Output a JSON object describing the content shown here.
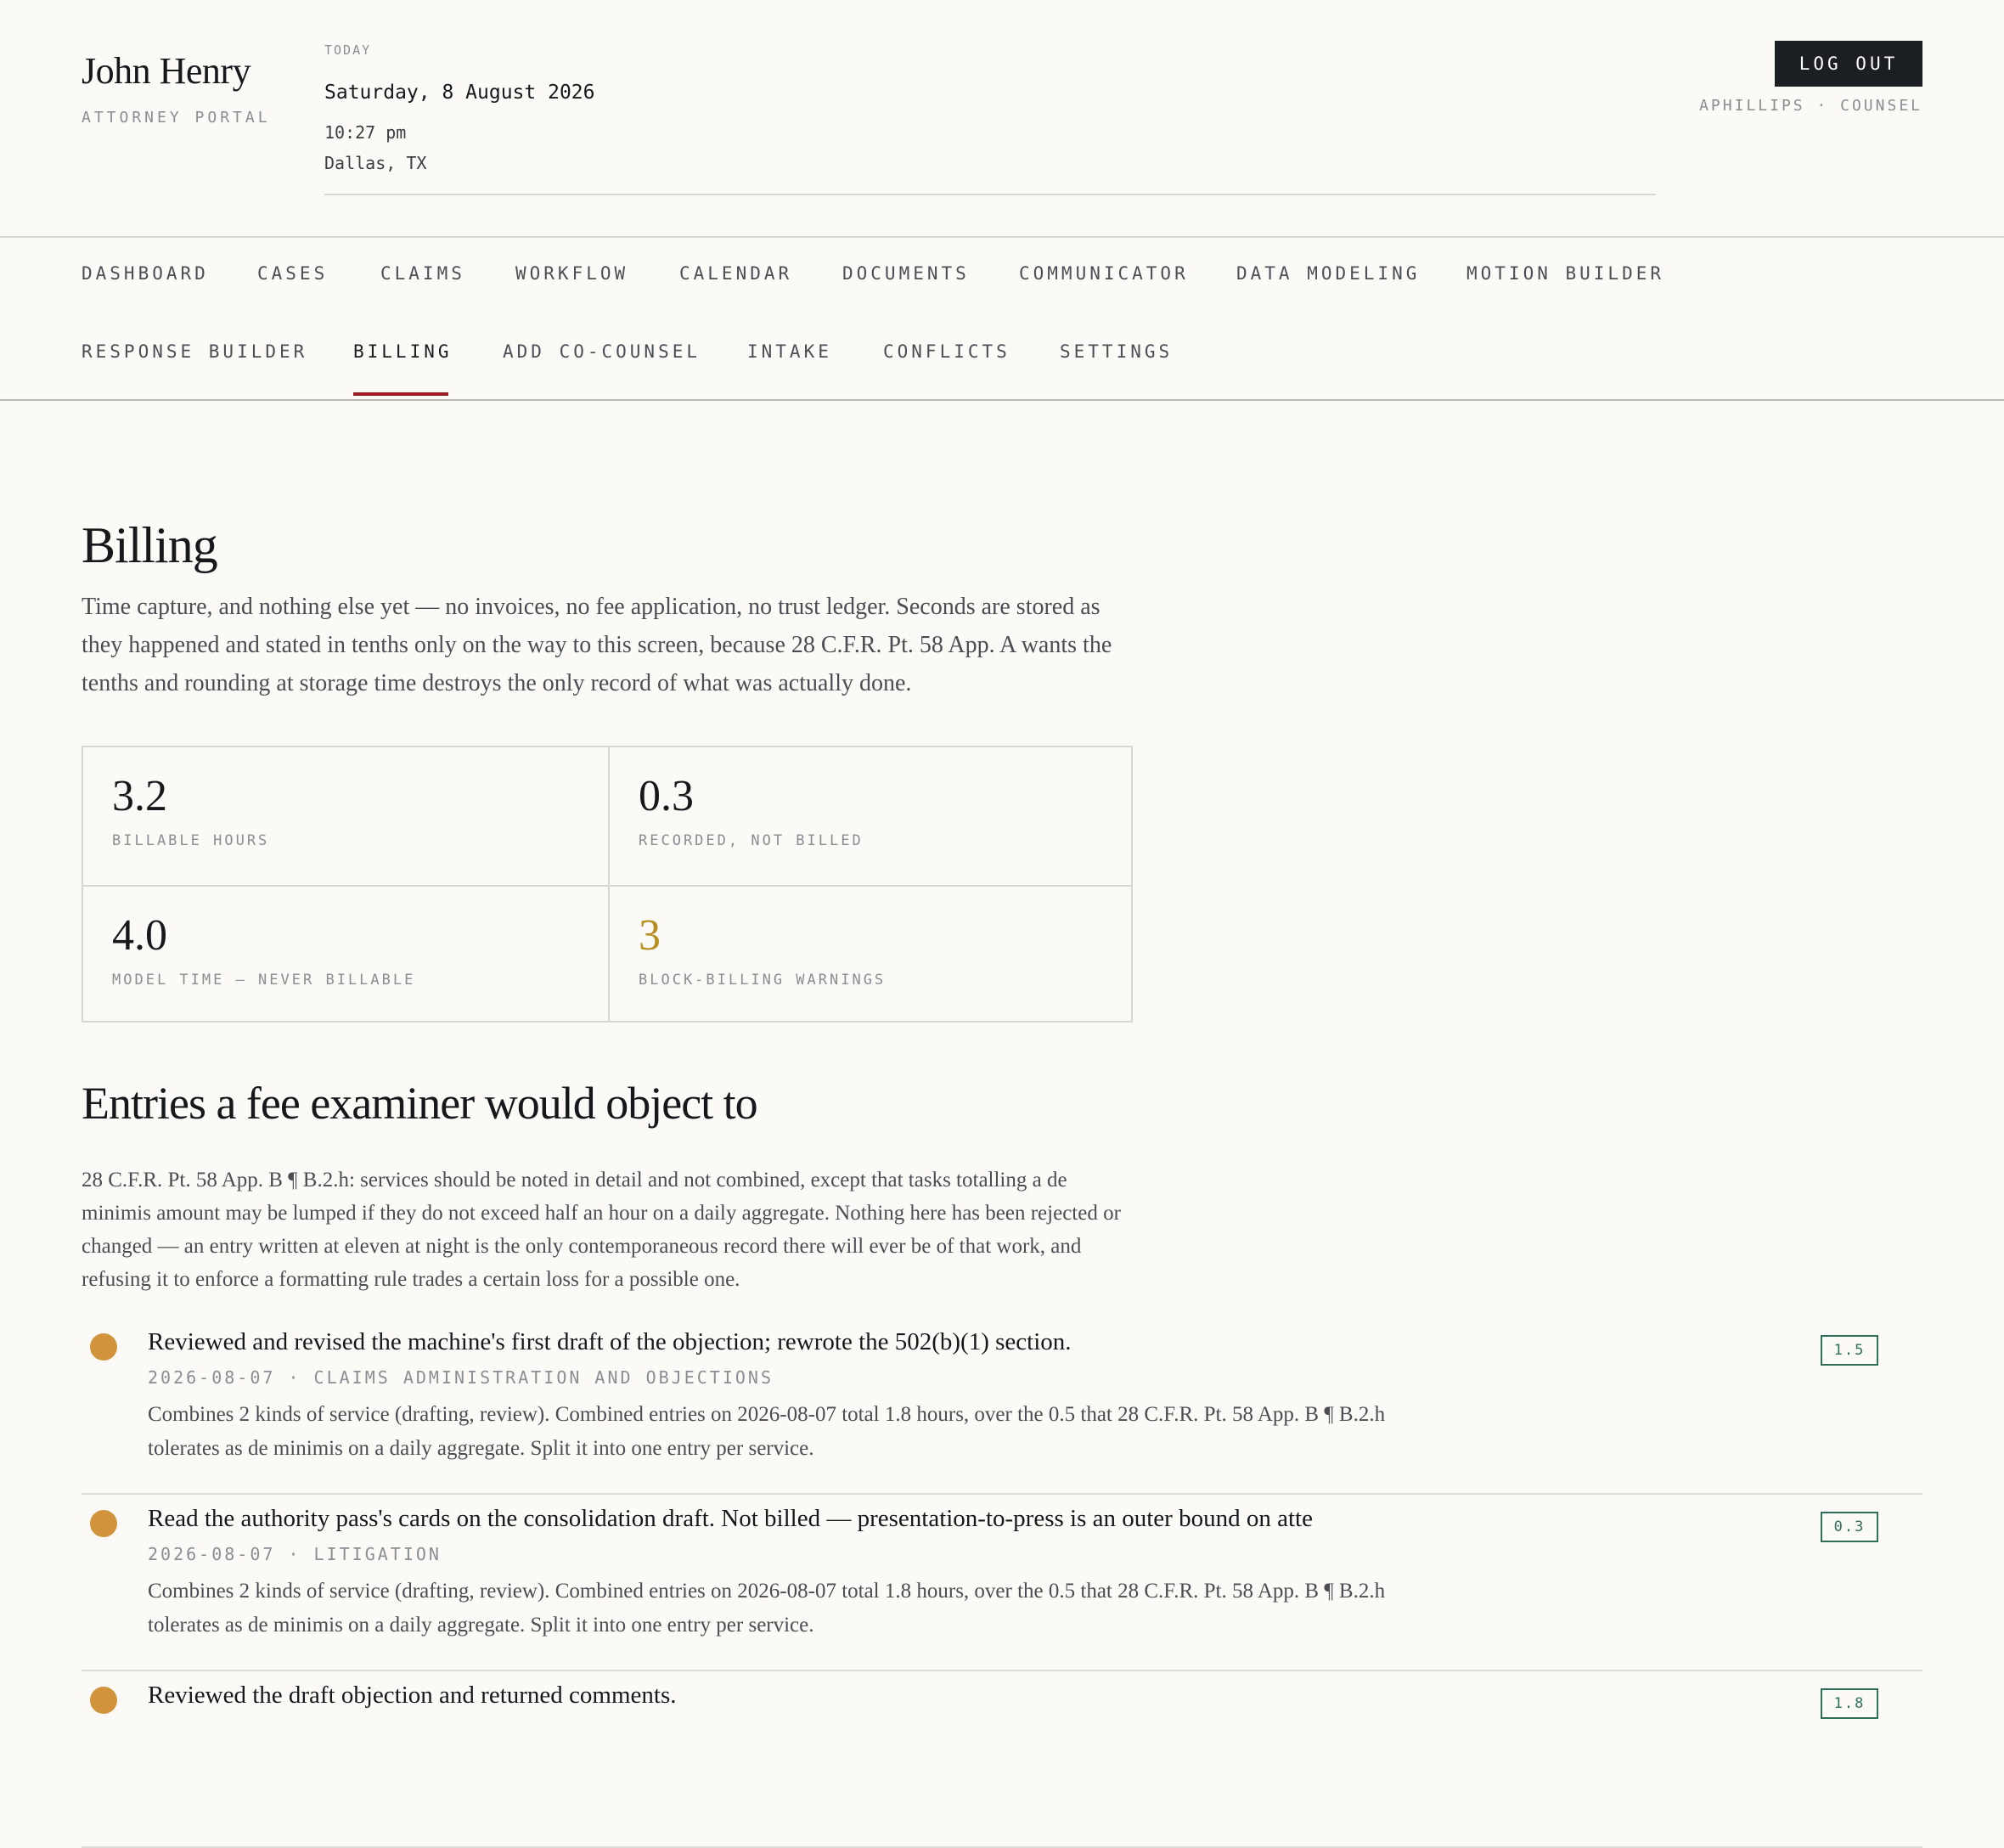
{
  "header": {
    "brand_name": "John Henry",
    "brand_sub": "ATTORNEY PORTAL",
    "today_label": "TODAY",
    "date": "Saturday, 8 August 2026",
    "time": "10:27 pm",
    "location": "Dallas, TX",
    "logout_label": "LOG OUT",
    "user_role": "APHILLIPS · COUNSEL"
  },
  "nav": {
    "items": [
      "DASHBOARD",
      "CASES",
      "CLAIMS",
      "WORKFLOW",
      "CALENDAR",
      "DOCUMENTS",
      "COMMUNICATOR",
      "DATA MODELING",
      "MOTION BUILDER",
      "RESPONSE BUILDER",
      "BILLING",
      "ADD CO-COUNSEL",
      "INTAKE",
      "CONFLICTS",
      "SETTINGS"
    ],
    "active": "BILLING",
    "accent_color": "#9e1c22"
  },
  "billing": {
    "title": "Billing",
    "intro": "Time capture, and nothing else yet — no invoices, no fee application, no trust ledger. Seconds are stored as they happened and stated in tenths only on the way to this screen, because 28 C.F.R. Pt. 58 App. A wants the tenths and rounding at storage time destroys the only record of what was actually done.",
    "stats": [
      {
        "value": "3.2",
        "label": "BILLABLE HOURS"
      },
      {
        "value": "0.3",
        "label": "RECORDED, NOT BILLED"
      },
      {
        "value": "4.0",
        "label": "MODEL TIME — NEVER BILLABLE"
      },
      {
        "value": "3",
        "label": "BLOCK-BILLING WARNINGS"
      }
    ],
    "warning_color": "#b78d1e"
  },
  "entries_section": {
    "title": "Entries a fee examiner would object to",
    "intro": "28 C.F.R. Pt. 58 App. B ¶ B.2.h: services should be noted in detail and not combined, except that tasks totalling a de minimis amount may be lumped if they do not exceed half an hour on a daily aggregate. Nothing here has been rejected or changed — an entry written at eleven at night is the only contemporaneous record there will ever be of that work, and refusing it to enforce a formatting rule trades a certain loss for a possible one.",
    "entries": [
      {
        "title": "Reviewed and revised the machine's first draft of the objection; rewrote the 502(b)(1) section.",
        "meta": "2026-08-07 · CLAIMS ADMINISTRATION AND OBJECTIONS",
        "warning": "Combines 2 kinds of service (drafting, review). Combined entries on 2026-08-07 total 1.8 hours, over the 0.5 that 28 C.F.R. Pt. 58 App. B ¶ B.2.h tolerates as de minimis on a daily aggregate. Split it into one entry per service.",
        "hours": "1.5"
      },
      {
        "title": "Read the authority pass's cards on the consolidation draft. Not billed — presentation-to-press is an outer bound on atte",
        "meta": "2026-08-07 · LITIGATION",
        "warning": "Combines 2 kinds of service (drafting, review). Combined entries on 2026-08-07 total 1.8 hours, over the 0.5 that 28 C.F.R. Pt. 58 App. B ¶ B.2.h tolerates as de minimis on a daily aggregate. Split it into one entry per service.",
        "hours": "0.3"
      },
      {
        "title": "Reviewed the draft objection and returned comments.",
        "meta": "",
        "warning": "",
        "hours": "1.8"
      }
    ],
    "dot_color": "#d1943c",
    "hours_color": "#2e6f57"
  }
}
